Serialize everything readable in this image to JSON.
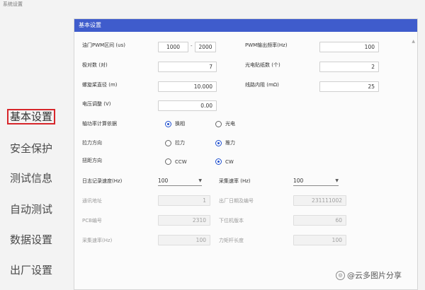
{
  "window_title": "系统设置",
  "nav": [
    {
      "label": "基本设置",
      "active": true
    },
    {
      "label": "安全保护",
      "active": false
    },
    {
      "label": "测试信息",
      "active": false
    },
    {
      "label": "自动测试",
      "active": false
    },
    {
      "label": "数据设置",
      "active": false
    },
    {
      "label": "出厂设置",
      "active": false
    }
  ],
  "panel_title": "基本设置",
  "fields": {
    "pwm_range_label": "油门PWM区间 (us)",
    "pwm_min": "1000",
    "pwm_sep": "-",
    "pwm_max": "2000",
    "pwm_freq_label": "PWM输出频率(Hz)",
    "pwm_freq": "100",
    "pole_label": "极对数 (对)",
    "pole": "7",
    "photo_label": "光电贴纸数 (个)",
    "photo": "2",
    "prop_label": "螺旋桨直径 (m)",
    "prop": "10.000",
    "line_res_label": "线路内阻 (mΩ)",
    "line_res": "25",
    "volt_label": "电压调整 (V)",
    "volt": "0.00"
  },
  "radios": {
    "shaft_label": "轴功率计算依据",
    "shaft_opt1": "换相",
    "shaft_opt2": "光电",
    "pull_label": "拉力方向",
    "pull_opt1": "拉力",
    "pull_opt2": "推力",
    "torque_label": "扭距方向",
    "torque_opt1": "CCW",
    "torque_opt2": "CW"
  },
  "selects": {
    "log_rate_label": "日志记录速度(Hz)",
    "log_rate": "100",
    "sample_rate_label": "采集速率 (Hz)",
    "sample_rate": "100"
  },
  "disabled": {
    "comm_addr_label": "通讯地址",
    "comm_addr": "1",
    "factory_date_label": "出厂日期及编号",
    "factory_date": "231111002",
    "pcb_label": "PCB编号",
    "pcb": "2310",
    "fw_label": "下位机版本",
    "fw": "60",
    "sample_label": "采集速率(Hz)",
    "sample": "100",
    "arm_label": "力矩杆长度",
    "arm": "100"
  },
  "watermark": "@云多图片分享",
  "colors": {
    "header": "#3f5ccc",
    "active_border": "#d7262b",
    "radio_on": "#1f4fcf"
  }
}
